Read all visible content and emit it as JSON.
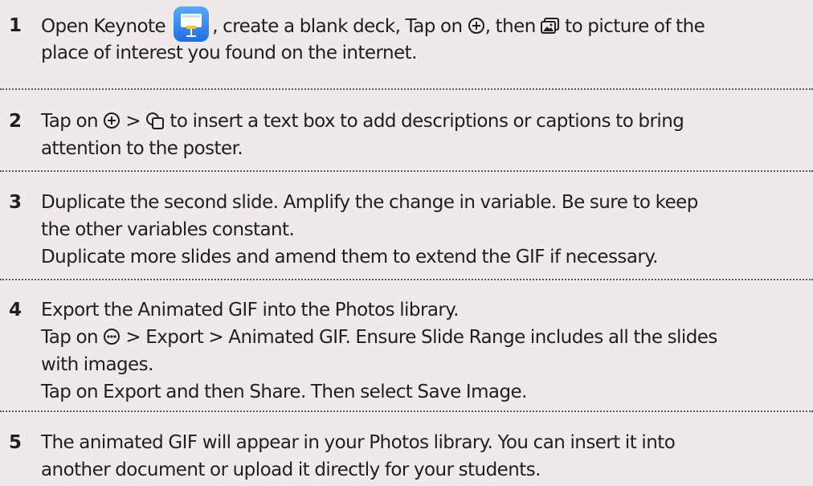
{
  "steps": [
    {
      "number": "1",
      "line1_a": "Open Keynote",
      "icon1": "keynote-app-icon",
      "line1_b": ", create a blank deck, Tap on",
      "icon2": "plus-circle-icon",
      "line1_c": ", then",
      "icon3": "photo-media-icon",
      "line1_d": "to picture of the",
      "line2": "place of interest you found on the internet."
    },
    {
      "number": "2",
      "line1_a": "Tap on",
      "icon1": "plus-circle-icon",
      "line1_b": ">",
      "icon2": "shapes-icon",
      "line1_c": "to insert a text box to add descriptions or captions to bring",
      "line2": "attention to the poster."
    },
    {
      "number": "3",
      "line1": "Duplicate the second slide. Amplify the change in variable. Be sure to keep",
      "line2": "the other variables constant.",
      "line3": "Duplicate more slides and amend them to extend the GIF if necessary."
    },
    {
      "number": "4",
      "line1": "Export the Animated GIF into the Photos library.",
      "line2_a": "Tap on",
      "icon1": "more-circle-icon",
      "line2_b": "> Export > Animated GIF. Ensure Slide Range includes all the slides",
      "line3": "with images.",
      "line4": "Tap on Export and then Share. Then select Save Image."
    },
    {
      "number": "5",
      "line1": "The animated GIF will appear in your Photos library. You can insert it into",
      "line2": "another document or upload it directly for your students."
    }
  ]
}
